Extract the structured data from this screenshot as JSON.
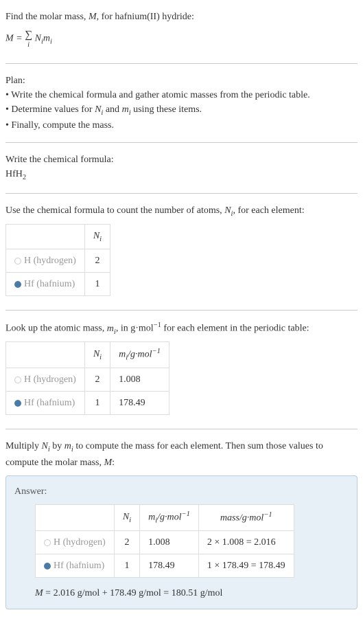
{
  "intro": {
    "line1": "Find the molar mass, ",
    "var_M": "M",
    "line1b": ", for hafnium(II) hydride:",
    "eq_lhs": "M",
    "eq_eq": " = ",
    "eq_sigma": "∑",
    "eq_sigma_sub": "i",
    "eq_rhs_N": "N",
    "eq_rhs_i1": "i",
    "eq_rhs_m": "m",
    "eq_rhs_i2": "i"
  },
  "plan": {
    "heading": "Plan:",
    "bullet1": "• Write the chemical formula and gather atomic masses from the periodic table.",
    "bullet2a": "• Determine values for ",
    "bullet2_N": "N",
    "bullet2_i1": "i",
    "bullet2b": " and ",
    "bullet2_m": "m",
    "bullet2_i2": "i",
    "bullet2c": " using these items.",
    "bullet3": "• Finally, compute the mass."
  },
  "formula_section": {
    "heading": "Write the chemical formula:",
    "formula_Hf": "HfH",
    "formula_sub": "2"
  },
  "count_section": {
    "text1": "Use the chemical formula to count the number of atoms, ",
    "var_N": "N",
    "var_i": "i",
    "text2": ", for each element:",
    "header_N": "N",
    "header_i": "i",
    "row_h_label": "H (hydrogen)",
    "row_h_val": "2",
    "row_hf_label": "Hf (hafnium)",
    "row_hf_val": "1"
  },
  "mass_section": {
    "text1": "Look up the atomic mass, ",
    "var_m": "m",
    "var_i": "i",
    "text2": ", in g·mol",
    "sup_neg1": "−1",
    "text3": " for each element in the periodic table:",
    "header_N": "N",
    "header_Ni": "i",
    "header_m": "m",
    "header_mi": "i",
    "header_unit": "/g·mol",
    "header_sup": "−1",
    "row_h_label": "H (hydrogen)",
    "row_h_N": "2",
    "row_h_m": "1.008",
    "row_hf_label": "Hf (hafnium)",
    "row_hf_N": "1",
    "row_hf_m": "178.49"
  },
  "multiply_section": {
    "text1": "Multiply ",
    "N": "N",
    "i1": "i",
    "text2": " by ",
    "m": "m",
    "i2": "i",
    "text3": " to compute the mass for each element. Then sum those values to compute the molar mass, ",
    "M": "M",
    "text4": ":"
  },
  "answer": {
    "label": "Answer:",
    "header_N": "N",
    "header_Ni": "i",
    "header_m": "m",
    "header_mi": "i",
    "header_munit": "/g·mol",
    "header_msup": "−1",
    "header_mass": "mass/g·mol",
    "header_mass_sup": "−1",
    "row_h_label": "H (hydrogen)",
    "row_h_N": "2",
    "row_h_m": "1.008",
    "row_h_mass": "2 × 1.008 = 2.016",
    "row_hf_label": "Hf (hafnium)",
    "row_hf_N": "1",
    "row_hf_m": "178.49",
    "row_hf_mass": "1 × 178.49 = 178.49",
    "final_M": "M",
    "final_eq": " = 2.016 g/mol + 178.49 g/mol = 180.51 g/mol"
  }
}
